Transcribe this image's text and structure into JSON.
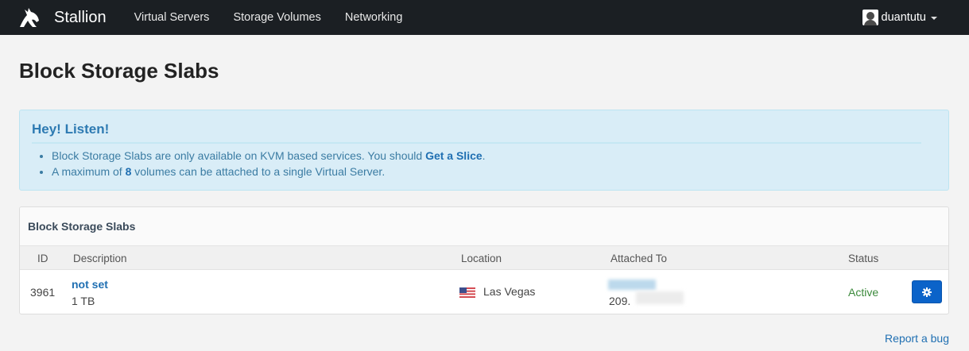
{
  "navbar": {
    "brand": "Stallion",
    "links": [
      "Virtual Servers",
      "Storage Volumes",
      "Networking"
    ],
    "user": "duantutu"
  },
  "page": {
    "title": "Block Storage Slabs"
  },
  "alert": {
    "title": "Hey! Listen!",
    "line1_text": "Block Storage Slabs are only available on KVM based services. You should ",
    "line1_link": "Get a Slice",
    "line1_end": ".",
    "line2_before": "A maximum of ",
    "line2_count": "8",
    "line2_after": " volumes can be attached to a single Virtual Server."
  },
  "panel": {
    "heading": "Block Storage Slabs",
    "columns": [
      "ID",
      "Description",
      "Location",
      "Attached To",
      "Status"
    ],
    "rows": [
      {
        "id": "3961",
        "description": "not set",
        "size": "1 TB",
        "location": "Las Vegas",
        "attached_to": "209.",
        "status": "Active"
      }
    ]
  },
  "footer": {
    "report_link": "Report a bug"
  },
  "colors": {
    "navbar": "#1b1f23",
    "link": "#1f6fb2",
    "active": "#3c8a3c",
    "button": "#0b63c9"
  },
  "icons": {
    "brand": "horse-head-icon",
    "row_action": "gear-icon",
    "location": "us-flag-icon"
  }
}
